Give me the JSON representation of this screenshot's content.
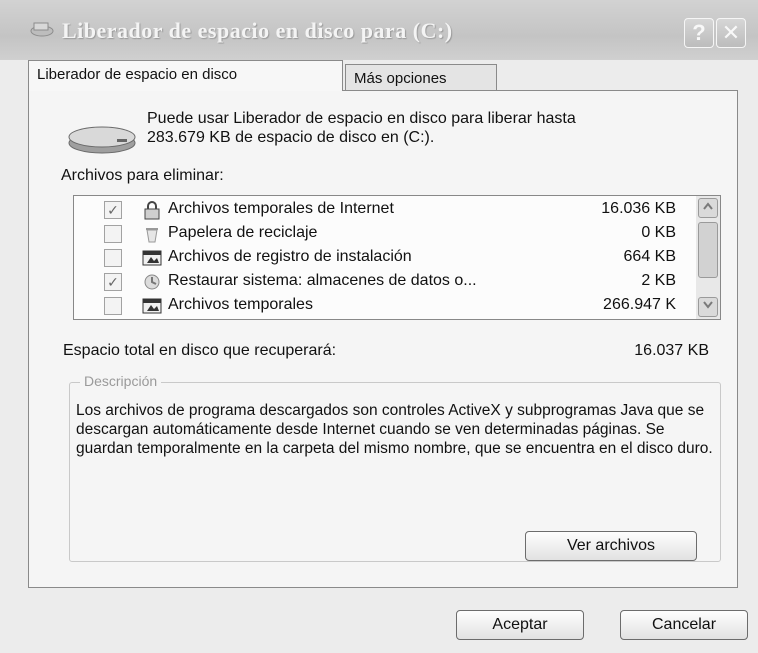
{
  "window": {
    "title": "Liberador de espacio en disco para  (C:)",
    "help_label": "?",
    "close_label": "✕"
  },
  "tabs": [
    {
      "label": "Liberador de espacio en disco",
      "active": true
    },
    {
      "label": "Más opciones",
      "active": false
    }
  ],
  "panel": {
    "intro_line1": "Puede usar Liberador de espacio en disco para liberar hasta",
    "intro_line2": "283.679 KB de espacio de disco en  (C:).",
    "files_label": "Archivos para eliminar:",
    "files": [
      {
        "checked": true,
        "icon": "lock-icon",
        "name": "Archivos temporales de Internet",
        "size": "16.036 KB"
      },
      {
        "checked": false,
        "icon": "recycle-bin-icon",
        "name": "Papelera de reciclaje",
        "size": "0 KB"
      },
      {
        "checked": false,
        "icon": "window-icon",
        "name": "Archivos de registro de instalación",
        "size": "664 KB"
      },
      {
        "checked": true,
        "icon": "restore-icon",
        "name": "Restaurar sistema: almacenes de datos o...",
        "size": "2 KB"
      },
      {
        "checked": false,
        "icon": "window-icon",
        "name": "Archivos temporales",
        "size": "266.947 K"
      }
    ],
    "check_mark": "✓",
    "total_label": "Espacio total en disco que recuperará:",
    "total_value": "16.037 KB",
    "description_legend": "Descripción",
    "description_text": "Los archivos de programa descargados son controles ActiveX y subprogramas Java que se descargan automáticamente desde Internet cuando se ven determinadas páginas. Se guardan temporalmente en la carpeta del mismo nombre, que se encuentra en el disco duro.",
    "view_files_button": "Ver archivos"
  },
  "buttons": {
    "ok": "Aceptar",
    "cancel": "Cancelar"
  }
}
